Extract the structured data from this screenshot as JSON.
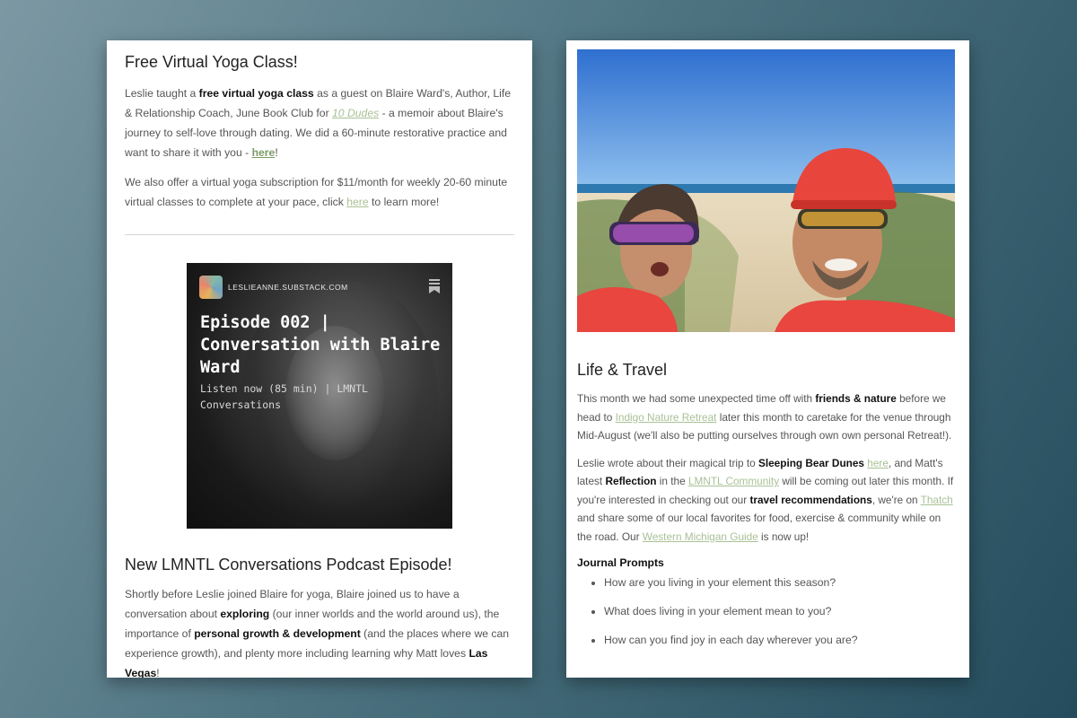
{
  "left": {
    "yoga": {
      "title": "Free Virtual Yoga Class!",
      "p1": {
        "t1": "Leslie taught a ",
        "b1": "free virtual yoga class",
        "t2": " as a guest on Blaire Ward's, Author, Life & Relationship Coach, June Book Club for ",
        "link1": "10 Dudes",
        "t3": " - a memoir about Blaire's journey to self-love through dating. We did a 60-minute restorative practice and want to share it with you - ",
        "link2": "here",
        "t4": "!"
      },
      "p2": {
        "t1": "We also offer a virtual yoga subscription for $11/month for weekly 20-60 minute virtual classes to complete at your pace, click ",
        "link": "here",
        "t2": " to learn more!"
      }
    },
    "podcast_card": {
      "site": "LESLIEANNE.SUBSTACK.COM",
      "title": "Episode 002 | Conversation with Blaire Ward",
      "subtitle": "Listen now (85 min) | LMNTL Conversations"
    },
    "podcast": {
      "title": "New LMNTL Conversations Podcast Episode!",
      "p": {
        "t1": "Shortly before Leslie joined Blaire for yoga, Blaire joined us to have a conversation about ",
        "b1": "exploring",
        "t2": " (our inner worlds and the world around us), the importance of ",
        "b2": "personal growth & development",
        "t3": " (and the places where we can experience growth), and plenty more including learning why Matt loves ",
        "b3": "Las Vegas",
        "t4": "!"
      }
    }
  },
  "right": {
    "title": "Life & Travel",
    "p1": {
      "t1": "This month we had some unexpected time off with ",
      "b1": "friends & nature",
      "t2": " before we head to ",
      "link1": "Indigo Nature Retreat",
      "t3": " later this month to caretake for the venue through Mid-August (we'll also be putting ourselves through own own personal Retreat!)."
    },
    "p2": {
      "t1": "Leslie wrote about their magical trip to ",
      "b1": "Sleeping Bear Dunes",
      "t2": " ",
      "link1": "here",
      "t3": ", and Matt's latest ",
      "b2": "Reflection",
      "t4": " in the ",
      "link2": "LMNTL Community",
      "t5": " will be coming out later this month. If you're interested in checking out our ",
      "b3": "travel recommendations",
      "t6": ", we're on ",
      "link3": "Thatch",
      "t7": " and share some of our local favorites for food, exercise & community while on the road. Our ",
      "link4": "Western Michigan Guide",
      "t8": " is now up!"
    },
    "journal": {
      "title": "Journal Prompts",
      "prompts": [
        "How are you living in your element this season?",
        "What does living in your element mean to you?",
        "How can you find joy in each day wherever you are?"
      ]
    }
  },
  "colors": {
    "link": "#a9c196",
    "bg_dark": "#244c5c",
    "bg_light": "#7c98a3",
    "helmet": "#e8453c",
    "jersey": "#e8463f"
  },
  "icons": [
    "substack-logo-icon",
    "bookmark-icon"
  ]
}
